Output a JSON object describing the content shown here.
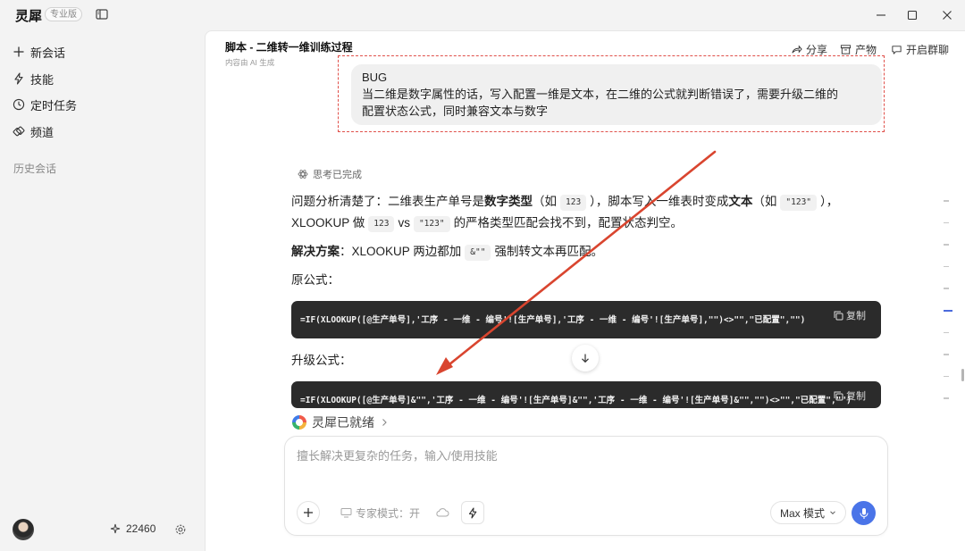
{
  "app": {
    "brand": "灵犀",
    "edition": "专业版"
  },
  "sidebar": {
    "items": [
      {
        "label": "新会话",
        "icon": "plus-icon"
      },
      {
        "label": "技能",
        "icon": "lightning-icon"
      },
      {
        "label": "定时任务",
        "icon": "clock-icon"
      },
      {
        "label": "频道",
        "icon": "channel-icon"
      }
    ],
    "history_title": "历史会话",
    "credits": "22460"
  },
  "header": {
    "title": "脚本 - 二维转一维训练过程",
    "subtitle": "内容由 AI 生成",
    "share": "分享",
    "artifacts": "产物",
    "group_chat": "开启群聊"
  },
  "user_message": {
    "lines": [
      "BUG",
      "当二维是数字属性的话，写入配置一维是文本，在二维的公式就判断错误了，需要升级二维的",
      "配置状态公式，同时兼容文本与数字"
    ]
  },
  "response": {
    "thinking_label": "思考已完成",
    "p1_a": "问题分析清楚了：二维表生产单号是",
    "p1_b": "数字类型",
    "p1_c": "（如",
    "p1_code1": "123",
    "p1_d": "），脚本写入一维表时变成",
    "p1_e": "文本",
    "p1_f": "（如",
    "p1_code2": "\"123\"",
    "p1_g": "），",
    "p2_a": "XLOOKUP 做",
    "p2_code1": "123",
    "p2_b": "vs",
    "p2_code2": "\"123\"",
    "p2_c": "的严格类型匹配会找不到，配置状态判空。",
    "p3_a": "解决方案",
    "p3_b": "：XLOOKUP 两边都加",
    "p3_code": "&\"\"",
    "p3_c": "强制转文本再匹配。",
    "original_label": "原公式：",
    "original_code": "=IF(XLOOKUP([@生产单号],'工序 - 一维 - 编号'![生产单号],'工序 - 一维 - 编号'![生产单号],\"\")<>\"\",\"已配置\",\"\")",
    "upgraded_label": "升级公式：",
    "upgraded_code": "=IF(XLOOKUP([@生产单号]&\"\",'工序 - 一维 - 编号'![生产单号]&\"\",'工序 - 一维 - 编号'![生产单号]&\"\",\"\")<>\"\",\"已配置\",\"\")",
    "copy_label": "复制"
  },
  "status": {
    "ready_label": "灵犀已就绪"
  },
  "composer": {
    "placeholder": "擅长解决更复杂的任务，输入/使用技能",
    "expert_mode": "专家模式：开",
    "model": "Max 模式"
  },
  "annotation": {
    "color": "#e0504a"
  }
}
